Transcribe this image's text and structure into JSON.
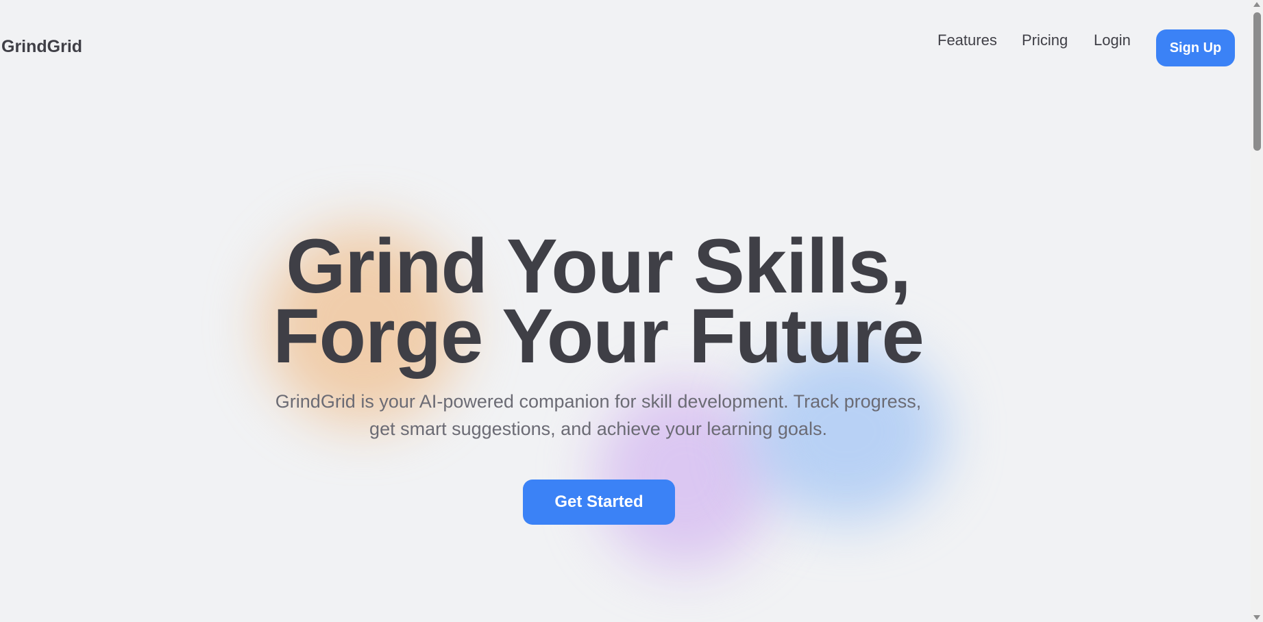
{
  "header": {
    "logo": "GrindGrid",
    "nav": [
      "Features",
      "Pricing",
      "Login"
    ],
    "signup_label": "Sign Up"
  },
  "hero": {
    "title_line1": "Grind Your Skills,",
    "title_line2": "Forge Your Future",
    "subtitle_line1": "GrindGrid is your AI-powered companion for skill development. Track progress,",
    "subtitle_line2": "get smart suggestions, and achieve your learning goals.",
    "cta_label": "Get Started"
  },
  "colors": {
    "accent": "#3b82f6",
    "background": "#f1f2f4",
    "text": "#3f3f46"
  }
}
